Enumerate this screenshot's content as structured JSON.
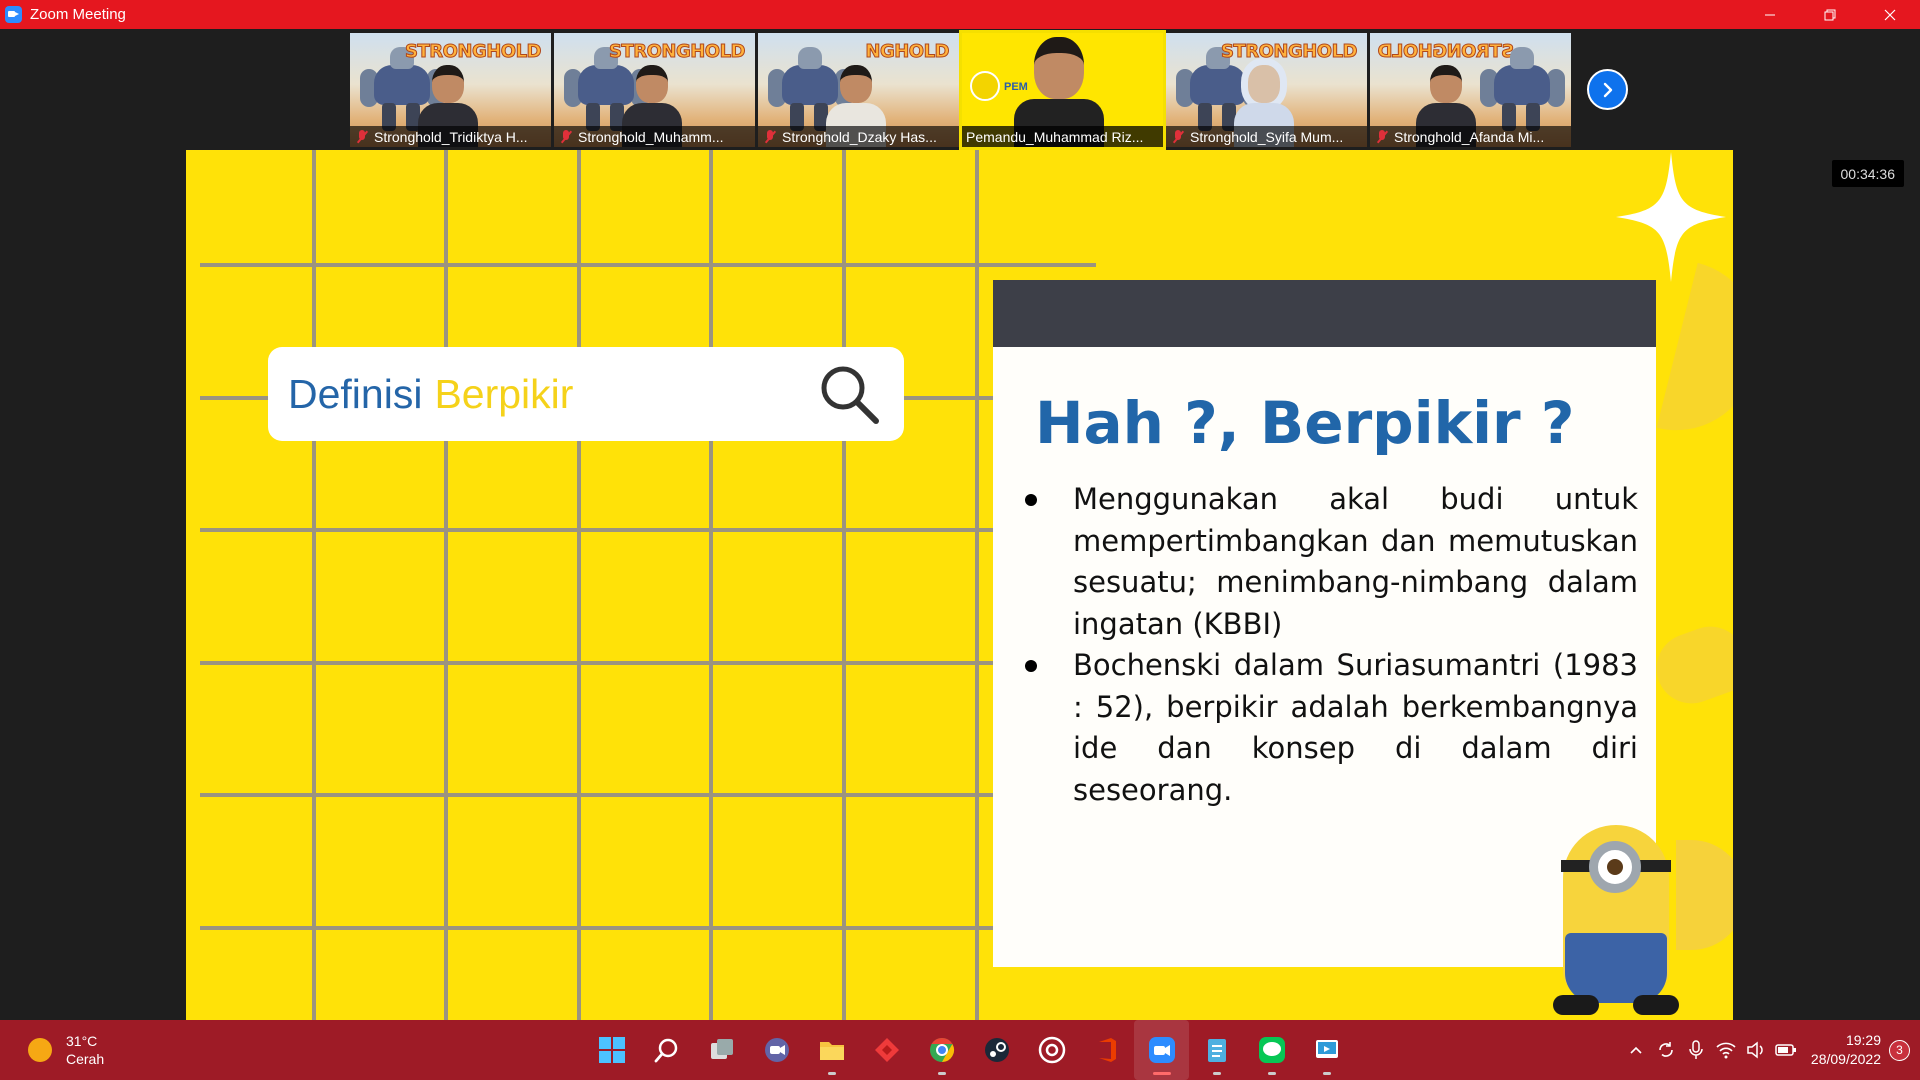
{
  "window": {
    "title": "Zoom Meeting",
    "controls": [
      "minimize",
      "restore",
      "close"
    ]
  },
  "gallery": {
    "participants": [
      {
        "name": "Stronghold_Tridiktya H...",
        "muted": true,
        "background": "Stronghold banner",
        "brand": "STRONGHOLD"
      },
      {
        "name": "Stronghold_Muhamm...",
        "muted": true,
        "background": "Stronghold banner",
        "brand": "STRONGHOLD"
      },
      {
        "name": "Stronghold_Dzaky Has...",
        "muted": true,
        "background": "Stronghold banner",
        "brand": "NGHOLD"
      },
      {
        "name": "Pemandu_Muhammad Riz...",
        "muted": false,
        "active_speaker": true,
        "background": "yellow",
        "brand": "PEM"
      },
      {
        "name": "Stronghold_Syifa Mum...",
        "muted": true,
        "background": "Stronghold banner",
        "brand": "STRONGHOLD"
      },
      {
        "name": "Stronghold_Afanda Mi...",
        "muted": true,
        "background": "Stronghold banner",
        "brand": "STRONGHOLD"
      }
    ],
    "next_page_icon": "chevron-right-icon"
  },
  "meeting_timer": "00:34:36",
  "slide": {
    "search_bar": {
      "word1": "Definisi",
      "word2": "Berpikir",
      "icon": "search-icon"
    },
    "card": {
      "title": "Hah ?, Berpikir ?",
      "bullets": [
        "Menggunakan akal budi untuk mempertimbangkan dan memutuskan sesuatu; menimbang-nimbang dalam ingatan (KBBI)",
        "Bochenski dalam Suriasumantri (1983 : 52), berpikir adalah berkembangnya ide dan konsep di dalam diri seseorang."
      ]
    },
    "colors": {
      "background": "#ffe208",
      "grid": "#9b9480",
      "title_blue": "#2166a9",
      "accent_yellow": "#f5d21a",
      "card_header": "#3d3f48"
    }
  },
  "taskbar": {
    "weather": {
      "temperature": "31°C",
      "condition": "Cerah"
    },
    "apps": [
      {
        "name": "Start",
        "icon": "windows-start-icon"
      },
      {
        "name": "Search",
        "icon": "search-icon"
      },
      {
        "name": "Task View",
        "icon": "task-view-icon"
      },
      {
        "name": "Teams Meet",
        "icon": "meet-icon"
      },
      {
        "name": "File Explorer",
        "icon": "folder-icon",
        "running": true
      },
      {
        "name": "AnyDesk",
        "icon": "anydesk-icon"
      },
      {
        "name": "Chrome",
        "icon": "chrome-icon",
        "running": true
      },
      {
        "name": "Steam",
        "icon": "steam-icon"
      },
      {
        "name": "Ubisoft",
        "icon": "ubisoft-icon"
      },
      {
        "name": "Office",
        "icon": "office-icon"
      },
      {
        "name": "Zoom",
        "icon": "zoom-icon",
        "running": true,
        "current": true
      },
      {
        "name": "Notepad",
        "icon": "notepad-icon",
        "running": true
      },
      {
        "name": "LINE",
        "icon": "line-icon",
        "running": true
      },
      {
        "name": "Remote",
        "icon": "remote-icon",
        "running": true
      }
    ],
    "tray": {
      "icons": [
        "chevron-up-icon",
        "sync-icon",
        "microphone-icon",
        "wifi-icon",
        "volume-icon",
        "battery-icon"
      ],
      "time": "19:29",
      "date": "28/09/2022",
      "notifications": "3"
    }
  }
}
